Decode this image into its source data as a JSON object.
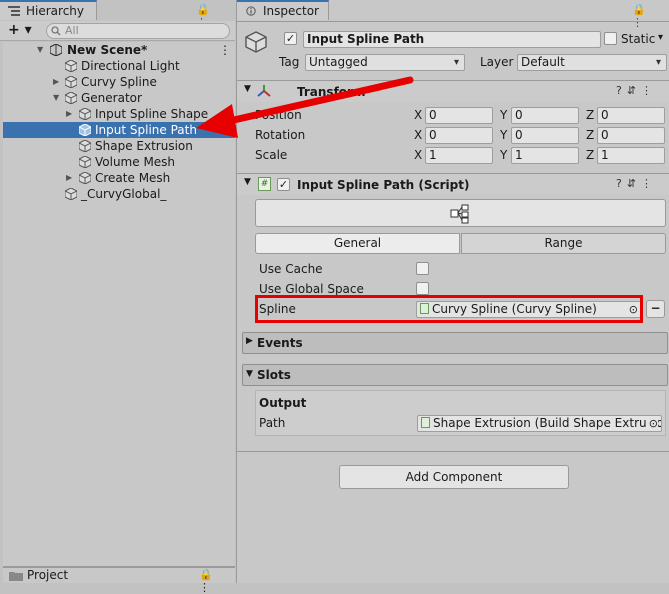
{
  "hierarchy": {
    "tab_label": "Hierarchy",
    "add_button": "+ ▾",
    "search_placeholder": "All",
    "items": [
      {
        "label": "New Scene*"
      },
      {
        "label": "Directional Light"
      },
      {
        "label": "Curvy Spline"
      },
      {
        "label": "Generator"
      },
      {
        "label": "Input Spline Shape"
      },
      {
        "label": "Input Spline Path"
      },
      {
        "label": "Shape Extrusion"
      },
      {
        "label": "Volume Mesh"
      },
      {
        "label": "Create Mesh"
      },
      {
        "label": "_CurvyGlobal_"
      }
    ],
    "selected_item": "Input Spline Path"
  },
  "project": {
    "tab_label": "Project"
  },
  "inspector": {
    "tab_label": "Inspector",
    "object_name": "Input Spline Path",
    "static_label": "Static",
    "tag_label": "Tag",
    "tag_value": "Untagged",
    "layer_label": "Layer",
    "layer_value": "Default",
    "transform": {
      "title": "Transform",
      "rows": [
        {
          "label": "Position",
          "x": "0",
          "y": "0",
          "z": "0"
        },
        {
          "label": "Rotation",
          "x": "0",
          "y": "0",
          "z": "0"
        },
        {
          "label": "Scale",
          "x": "1",
          "y": "1",
          "z": "1"
        }
      ],
      "axis_x": "X",
      "axis_y": "Y",
      "axis_z": "Z"
    },
    "script": {
      "title": "Input Spline Path (Script)",
      "tabs": [
        "General",
        "Range"
      ],
      "use_cache_label": "Use Cache",
      "use_global_space_label": "Use Global Space",
      "spline_label": "Spline",
      "spline_value": "Curvy Spline (Curvy Spline)",
      "minus_label": "−",
      "events_label": "Events",
      "slots_label": "Slots",
      "output_label": "Output",
      "path_label": "Path",
      "path_value": "Shape Extrusion (Build Shape Extrusion)"
    },
    "add_component_label": "Add Component"
  },
  "annotation": {
    "arrow_color": "#e60000"
  }
}
